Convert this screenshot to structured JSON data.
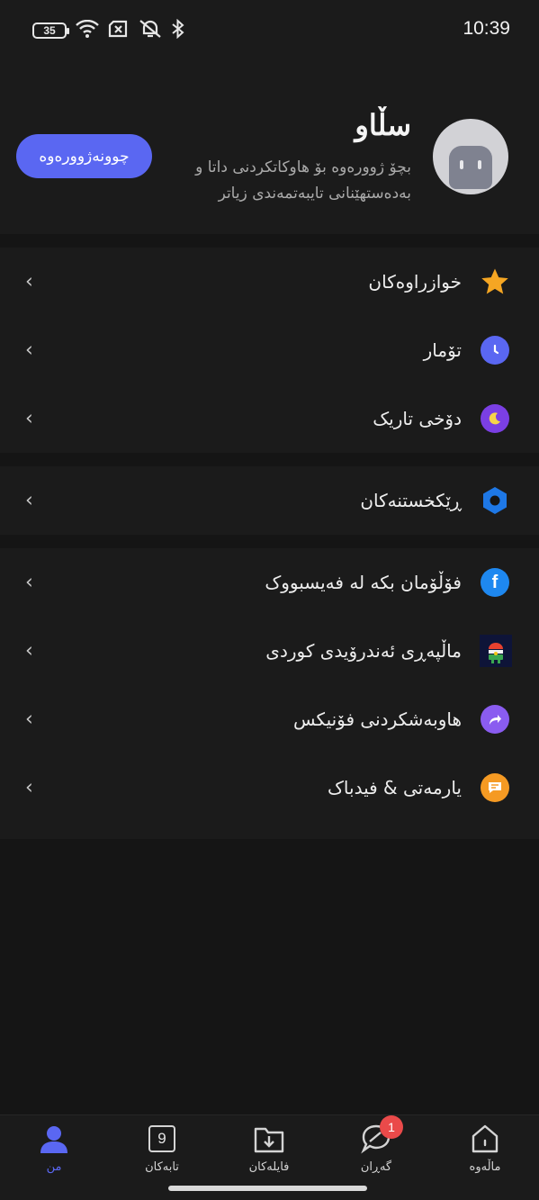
{
  "status_bar": {
    "battery": "35",
    "time": "10:39"
  },
  "header": {
    "greeting": "سڵاو",
    "subtitle": "بچۆ ژوورەوە بۆ هاوکاتکردنی داتا و بەدەستهێنانی تایبەتمەندی زیاتر",
    "login_button": "چوونەژوورەوە"
  },
  "menu": {
    "section1": [
      {
        "label": "خوازراوەکان",
        "icon": "star-icon"
      },
      {
        "label": "تۆمار",
        "icon": "history-icon"
      },
      {
        "label": "دۆخی تاریک",
        "icon": "moon-icon"
      }
    ],
    "section2": [
      {
        "label": "ڕێکخستنەکان",
        "icon": "settings-icon"
      }
    ],
    "section3": [
      {
        "label": "فۆڵۆمان بکە لە فەیسبووک",
        "icon": "facebook-icon"
      },
      {
        "label": "ماڵپەڕی ئەندرۆیدی کوردی",
        "icon": "kurdish-android-logo"
      },
      {
        "label": "هاوبەشکردنی فۆنیکس",
        "icon": "share-icon"
      },
      {
        "label": "یارمەتی & فیدباک",
        "icon": "feedback-icon"
      }
    ]
  },
  "bottom_nav": {
    "home": "ماڵەوە",
    "explore": "گەڕان",
    "explore_badge": "1",
    "files": "فایلەکان",
    "tabs": "تابەکان",
    "tabs_count": "9",
    "me": "من"
  },
  "colors": {
    "accent": "#5a67f2",
    "star": "#f5a623",
    "history": "#5a67f2",
    "moon": "#7b3fe4",
    "settings": "#1e78e6",
    "facebook": "#1e88f0",
    "share": "#8a5cf0",
    "feedback": "#f59a23",
    "badge": "#ea4a4a"
  }
}
